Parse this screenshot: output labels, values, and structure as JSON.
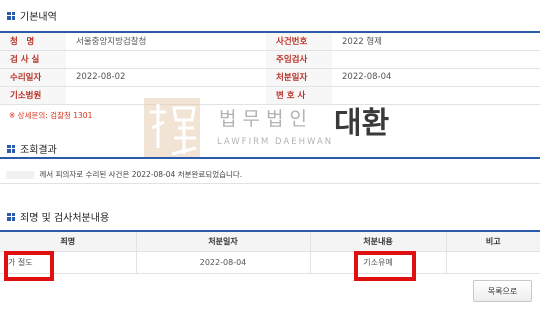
{
  "basic": {
    "title": "기본내역",
    "rows": [
      {
        "label1": "청　명",
        "value1": "서울중앙지방검찰청",
        "label2": "사건번호",
        "value2": "2022 형제"
      },
      {
        "label1": "검 사 실",
        "value1": "",
        "label2": "주임검사",
        "value2": ""
      },
      {
        "label1": "수리일자",
        "value1": "2022-08-02",
        "label2": "처분일자",
        "value2": "2022-08-04"
      },
      {
        "label1": "기소범원",
        "value1": "",
        "label2": "변 호 사",
        "value2": ""
      }
    ]
  },
  "contact": "※ 상세문의: 검찰청 1301",
  "inquiry": {
    "title": "조회결과",
    "message": "께서 피의자로 수리된 사건은 2022-08-04 처분완료되었습니다."
  },
  "crimes": {
    "title": "죄명 및 검사처분내용",
    "headers": [
      "죄명",
      "처분일자",
      "처분내용",
      "비고"
    ],
    "row": [
      "가 절도",
      "2022-08-04",
      "기소유예",
      ""
    ]
  },
  "list_button": "목록으로",
  "watermark": {
    "kr": "법무법인",
    "name": "대환",
    "en": "LAWFIRM DAEHWAN"
  },
  "colors": {
    "accent": "#2b5aa8",
    "label_red": "#b8332a",
    "highlight": "#e01010"
  }
}
